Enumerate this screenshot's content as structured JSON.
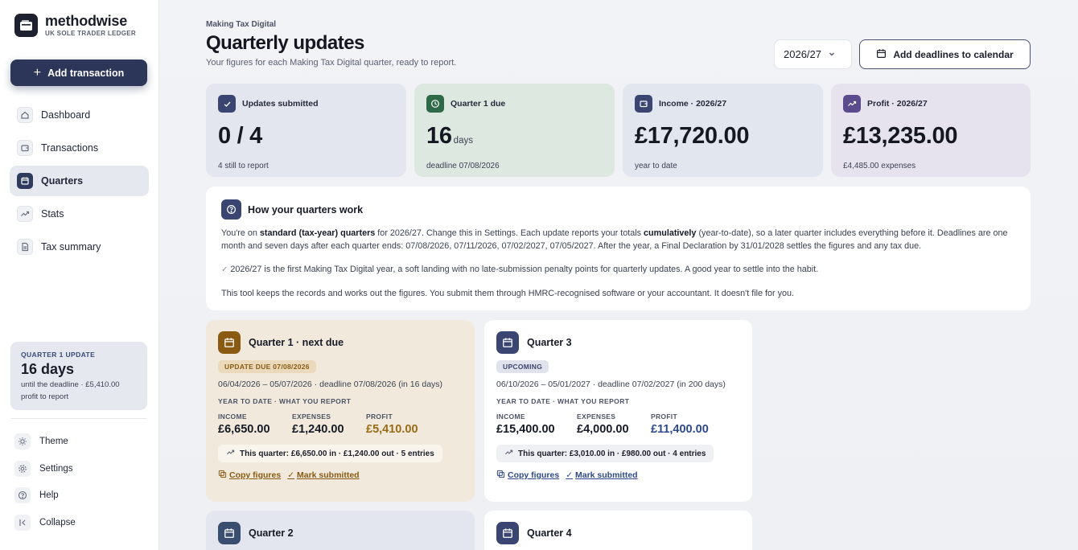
{
  "brand": {
    "name": "methodwise",
    "subtitle": "UK SOLE TRADER LEDGER"
  },
  "sidebar": {
    "add_label": "Add transaction",
    "items": [
      {
        "label": "Dashboard",
        "icon": "home-icon"
      },
      {
        "label": "Transactions",
        "icon": "wallet-icon"
      },
      {
        "label": "Quarters",
        "icon": "calendar-icon",
        "active": true
      },
      {
        "label": "Stats",
        "icon": "trend-icon"
      },
      {
        "label": "Tax summary",
        "icon": "document-icon"
      }
    ],
    "deadline_card": {
      "kicker": "QUARTER 1 UPDATE",
      "value": "16 days",
      "line1": "until the deadline · £5,410.00",
      "line2": "profit to report"
    },
    "bottom": [
      {
        "label": "Theme",
        "icon": "sun-icon"
      },
      {
        "label": "Settings",
        "icon": "gear-icon"
      },
      {
        "label": "Help",
        "icon": "help-icon"
      },
      {
        "label": "Collapse",
        "icon": "collapse-icon"
      }
    ]
  },
  "header": {
    "crumb": "Making Tax Digital",
    "title": "Quarterly updates",
    "subtitle": "Your figures for each Making Tax Digital quarter, ready to report.",
    "year": "2026/27",
    "calendar_button": "Add deadlines to calendar"
  },
  "stats": [
    {
      "label": "Updates submitted",
      "value": "0 / 4",
      "unit": "",
      "sub": "4 still to report",
      "bg": "#e3e6ee",
      "icon_bg": "#3a4572",
      "icon": "check-icon"
    },
    {
      "label": "Quarter 1 due",
      "value": "16",
      "unit": "days",
      "sub": "deadline 07/08/2026",
      "bg": "#dde8e1",
      "icon_bg": "#2f6a48",
      "icon": "clock-icon"
    },
    {
      "label": "Income · 2026/27",
      "value": "£17,720.00",
      "unit": "",
      "sub": "year to date",
      "bg": "#e2e6ef",
      "icon_bg": "#3a4572",
      "icon": "wallet-icon"
    },
    {
      "label": "Profit · 2026/27",
      "value": "£13,235.00",
      "unit": "",
      "sub": "£4,485.00 expenses",
      "bg": "#e6e3ef",
      "icon_bg": "#5b4a8c",
      "icon": "trend-icon"
    }
  ],
  "info": {
    "title": "How your quarters work",
    "p1_a": "You're on ",
    "p1_b": "standard (tax-year) quarters",
    "p1_c": " for 2026/27. Change this in Settings. Each update reports your totals ",
    "p1_d": "cumulatively",
    "p1_e": " (year-to-date), so a later quarter includes everything before it. Deadlines are one month and seven days after each quarter ends: 07/08/2026, 07/11/2026, 07/02/2027, 07/05/2027. After the year, a Final Declaration by 31/01/2028 settles the figures and any tax due.",
    "p2": "2026/27 is the first Making Tax Digital year, a soft landing with no late-submission penalty points for quarterly updates. A good year to settle into the habit.",
    "p3": "This tool keeps the records and works out the figures. You submit them through HMRC-recognised software or your accountant. It doesn't file for you."
  },
  "quarters": [
    {
      "title": "Quarter 1 · next due",
      "badge": "UPDATE DUE 07/08/2026",
      "dates": "06/04/2026 – 05/07/2026 · deadline 07/08/2026 (in 16 days)",
      "ytd_label": "YEAR TO DATE · WHAT YOU REPORT",
      "income_label": "INCOME",
      "income": "£6,650.00",
      "expenses_label": "EXPENSES",
      "expenses": "£1,240.00",
      "profit_label": "PROFIT",
      "profit": "£5,410.00",
      "chip": "This quarter: £6,650.00 in · £1,240.00 out · 5 entries",
      "copy": "Copy figures",
      "mark": "Mark submitted"
    },
    {
      "title": "Quarter 3",
      "badge": "UPCOMING",
      "dates": "06/10/2026 – 05/01/2027 · deadline 07/02/2027 (in 200 days)",
      "ytd_label": "YEAR TO DATE · WHAT YOU REPORT",
      "income_label": "INCOME",
      "income": "£15,400.00",
      "expenses_label": "EXPENSES",
      "expenses": "£4,000.00",
      "profit_label": "PROFIT",
      "profit": "£11,400.00",
      "chip": "This quarter: £3,010.00 in · £980.00 out · 4 entries",
      "copy": "Copy figures",
      "mark": "Mark submitted"
    },
    {
      "title": "Quarter 2"
    },
    {
      "title": "Quarter 4"
    }
  ],
  "colors": {
    "accent_navy": "#2b3658",
    "due_card_bg": "#f1e9dc",
    "due_accent": "#8a5a12",
    "upcoming_accent": "#2e4a8a"
  }
}
